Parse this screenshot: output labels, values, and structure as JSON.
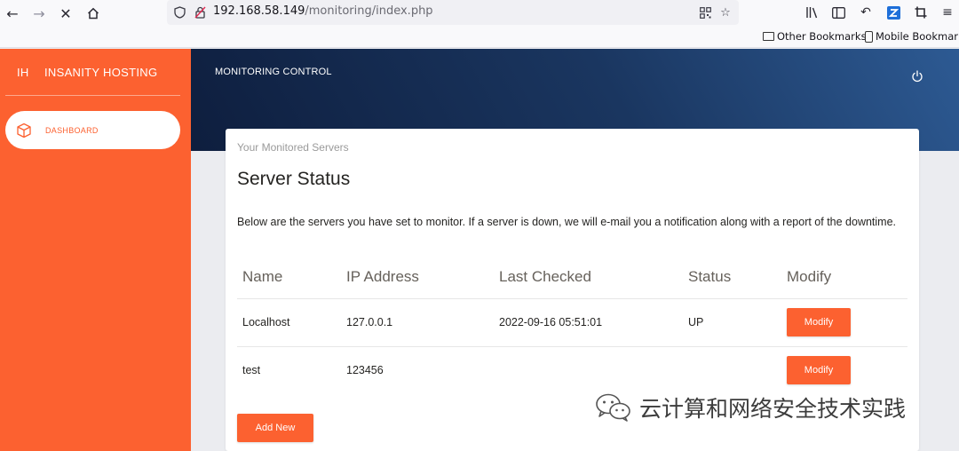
{
  "browser": {
    "url_host": "192.168.58.149",
    "url_path": "/monitoring/index.php",
    "bookmarks": [
      "Other Bookmarks",
      "Mobile Bookmarks"
    ]
  },
  "sidebar": {
    "brand_mini": "IH",
    "brand_name": "INSANITY HOSTING",
    "items": [
      {
        "label": "DASHBOARD",
        "icon": "cube-icon",
        "active": true
      }
    ]
  },
  "header": {
    "title": "MONITORING CONTROL"
  },
  "card": {
    "category": "Your Monitored Servers",
    "title": "Server Status",
    "description": "Below are the servers you have set to monitor. If a server is down, we will e-mail you a notification along with a report of the downtime.",
    "columns": [
      "Name",
      "IP Address",
      "Last Checked",
      "Status",
      "Modify"
    ],
    "rows": [
      {
        "name": "Localhost",
        "ip": "127.0.0.1",
        "last_checked": "2022-09-16 05:51:01",
        "status": "UP",
        "action": "Modify"
      },
      {
        "name": "test",
        "ip": "123456",
        "last_checked": "",
        "status": "",
        "action": "Modify"
      }
    ],
    "add_button": "Add New"
  },
  "watermark": {
    "text": "云计算和网络安全技术实践",
    "icon": "wechat-icon"
  },
  "colors": {
    "accent": "#fc6130",
    "header_dark": "#0e1e3e",
    "header_light": "#2d5a93"
  }
}
